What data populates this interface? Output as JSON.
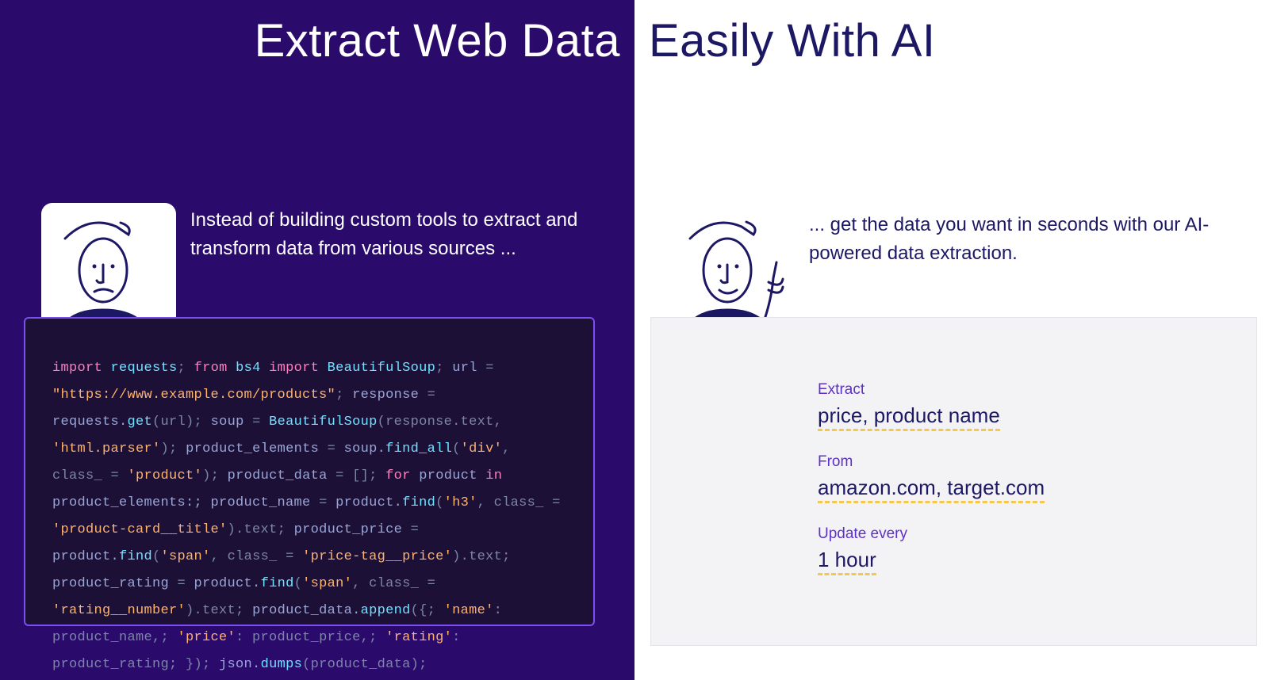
{
  "heading": {
    "left": "Extract Web Data",
    "right": "Easily With AI"
  },
  "left_panel": {
    "blurb": "Instead of building custom tools to extract and transform data from various sources ...",
    "code_tokens": [
      {
        "t": "import",
        "c": "kw"
      },
      {
        "t": " "
      },
      {
        "t": "requests",
        "c": "mod"
      },
      {
        "t": "; ",
        "c": "punc"
      },
      {
        "t": "from",
        "c": "kw"
      },
      {
        "t": " "
      },
      {
        "t": "bs4",
        "c": "mod"
      },
      {
        "t": " "
      },
      {
        "t": "import",
        "c": "kw"
      },
      {
        "t": " "
      },
      {
        "t": "BeautifulSoup",
        "c": "mod"
      },
      {
        "t": "; ",
        "c": "punc"
      },
      {
        "t": "url "
      },
      {
        "t": "=",
        "c": "punc"
      },
      {
        "t": " "
      },
      {
        "t": "\"https://www.example.com/products\"",
        "c": "str"
      },
      {
        "t": "; ",
        "c": "punc"
      },
      {
        "t": "response "
      },
      {
        "t": "=",
        "c": "punc"
      },
      {
        "t": " requests."
      },
      {
        "t": "get",
        "c": "fn"
      },
      {
        "t": "(url)",
        "c": "punc"
      },
      {
        "t": "; ",
        "c": "punc"
      },
      {
        "t": "soup "
      },
      {
        "t": "=",
        "c": "punc"
      },
      {
        "t": " "
      },
      {
        "t": "BeautifulSoup",
        "c": "fn"
      },
      {
        "t": "(response.text, ",
        "c": "punc"
      },
      {
        "t": "'html.parser'",
        "c": "str"
      },
      {
        "t": ")",
        "c": "punc"
      },
      {
        "t": "; ",
        "c": "punc"
      },
      {
        "t": "product_elements "
      },
      {
        "t": "=",
        "c": "punc"
      },
      {
        "t": " soup."
      },
      {
        "t": "find_all",
        "c": "fn"
      },
      {
        "t": "(",
        "c": "punc"
      },
      {
        "t": "'div'",
        "c": "str"
      },
      {
        "t": ", class_ ",
        "c": "punc"
      },
      {
        "t": "=",
        "c": "punc"
      },
      {
        "t": " "
      },
      {
        "t": "'product'",
        "c": "str"
      },
      {
        "t": ")",
        "c": "punc"
      },
      {
        "t": "; ",
        "c": "punc"
      },
      {
        "t": "product_data "
      },
      {
        "t": "=",
        "c": "punc"
      },
      {
        "t": " []",
        "c": "punc"
      },
      {
        "t": "; ",
        "c": "punc"
      },
      {
        "t": "for",
        "c": "kw"
      },
      {
        "t": " product "
      },
      {
        "t": "in",
        "c": "kw"
      },
      {
        "t": " product_elements:; product_name "
      },
      {
        "t": "=",
        "c": "punc"
      },
      {
        "t": " product."
      },
      {
        "t": "find",
        "c": "fn"
      },
      {
        "t": "(",
        "c": "punc"
      },
      {
        "t": "'h3'",
        "c": "str"
      },
      {
        "t": ", class_ ",
        "c": "punc"
      },
      {
        "t": "=",
        "c": "punc"
      },
      {
        "t": " "
      },
      {
        "t": "'product-card__title'",
        "c": "str"
      },
      {
        "t": ").text",
        "c": "punc"
      },
      {
        "t": "; ",
        "c": "punc"
      },
      {
        "t": "product_price "
      },
      {
        "t": "=",
        "c": "punc"
      },
      {
        "t": " product."
      },
      {
        "t": "find",
        "c": "fn"
      },
      {
        "t": "(",
        "c": "punc"
      },
      {
        "t": "'span'",
        "c": "str"
      },
      {
        "t": ", class_ ",
        "c": "punc"
      },
      {
        "t": "=",
        "c": "punc"
      },
      {
        "t": " "
      },
      {
        "t": "'price-tag__price'",
        "c": "str"
      },
      {
        "t": ").text",
        "c": "punc"
      },
      {
        "t": "; ",
        "c": "punc"
      },
      {
        "t": "product_rating "
      },
      {
        "t": "=",
        "c": "punc"
      },
      {
        "t": " product."
      },
      {
        "t": "find",
        "c": "fn"
      },
      {
        "t": "(",
        "c": "punc"
      },
      {
        "t": "'span'",
        "c": "str"
      },
      {
        "t": ", class_ ",
        "c": "punc"
      },
      {
        "t": "=",
        "c": "punc"
      },
      {
        "t": " "
      },
      {
        "t": "'rating__number'",
        "c": "str"
      },
      {
        "t": ").text",
        "c": "punc"
      },
      {
        "t": "; ",
        "c": "punc"
      },
      {
        "t": "product_data."
      },
      {
        "t": "append",
        "c": "fn"
      },
      {
        "t": "({; ",
        "c": "punc"
      },
      {
        "t": "'name'",
        "c": "str"
      },
      {
        "t": ": product_name,; ",
        "c": "punc"
      },
      {
        "t": "'price'",
        "c": "str"
      },
      {
        "t": ": product_price,; ",
        "c": "punc"
      },
      {
        "t": "'rating'",
        "c": "str"
      },
      {
        "t": ": product_rating; })",
        "c": "punc"
      },
      {
        "t": "; ",
        "c": "punc"
      },
      {
        "t": "json."
      },
      {
        "t": "dumps",
        "c": "fn"
      },
      {
        "t": "(product_data)",
        "c": "punc"
      },
      {
        "t": ";",
        "c": "punc"
      }
    ]
  },
  "right_panel": {
    "blurb": "... get the data you want in seconds with our AI-powered data extraction.",
    "fields": [
      {
        "label": "Extract",
        "value": "price, product name"
      },
      {
        "label": "From",
        "value": "amazon.com, target.com"
      },
      {
        "label": "Update every",
        "value": "1 hour"
      }
    ]
  }
}
